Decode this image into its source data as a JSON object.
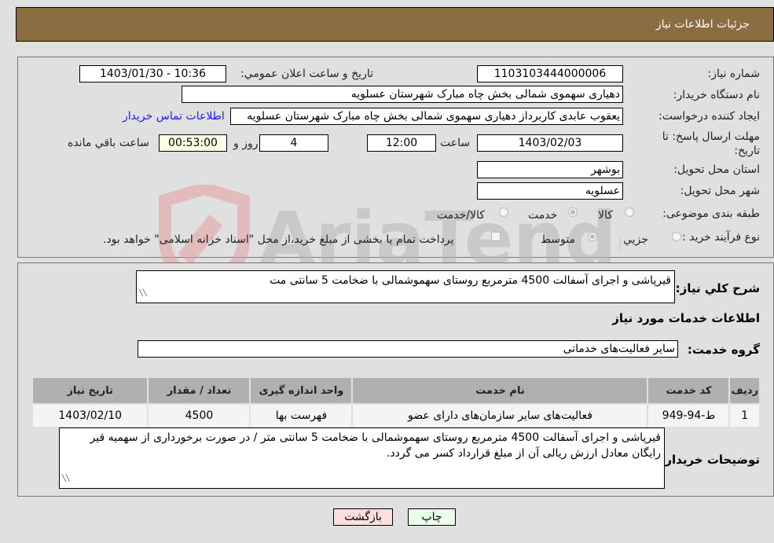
{
  "header": {
    "title": "جزئیات اطلاعات نیاز"
  },
  "fields": {
    "need_number": {
      "label": "شماره نیاز:",
      "value": "1103103444000006"
    },
    "announce_datetime": {
      "label": "تاریخ و ساعت اعلان عمومي:",
      "value": "1403/01/30 - 10:36"
    },
    "buyer_org": {
      "label": "نام دستگاه خریدار:",
      "value": "دهیاری سهموی شمالی بخش چاه مبارک شهرستان عسلویه"
    },
    "requester": {
      "label": "ایجاد کننده درخواست:",
      "value": "یعقوب عابدی کاربرداز دهیاری سهموی شمالی بخش چاه مبارک شهرستان عسلویه"
    },
    "contact_link": "اطلاعات تماس خریدار",
    "deadline": {
      "label": "مهلت ارسال پاسخ: تا تاریخ:",
      "date": "1403/02/03",
      "time_label": "ساعت",
      "time": "12:00",
      "days": "4",
      "days_label": "روز و",
      "remaining": "00:53:00",
      "remaining_label": "ساعت باقي مانده"
    },
    "province": {
      "label": "استان محل تحویل:",
      "value": "بوشهر"
    },
    "city": {
      "label": "شهر محل تحویل:",
      "value": "عسلویه"
    },
    "category": {
      "label": "طبقه بندی موضوعی:",
      "options": [
        "کالا",
        "خدمت",
        "کالا/خدمت"
      ],
      "selected": "خدمت"
    },
    "process_type": {
      "label": "نوع فرآیند خرید :",
      "options": [
        "جزيي",
        "متوسط"
      ],
      "selected": "متوسط",
      "treasury_note": "پرداخت تمام یا بخشی از مبلغ خرید،از محل \"اسناد خزانه اسلامی\" خواهد بود."
    }
  },
  "description": {
    "label": "شرح كلي نياز:",
    "value": "قیرپاشی و اجرای آسفالت 4500 مترمربع روستای سهموشمالی با ضخامت 5 سانتی مت"
  },
  "services_section_title": "اطلاعات خدمات مورد نیاز",
  "service_group": {
    "label": "گروه خدمت:",
    "value": "سایر فعالیت‌های خدماتی"
  },
  "table": {
    "headers": [
      "ردیف",
      "کد خدمت",
      "نام خدمت",
      "واحد اندازه گیری",
      "تعداد / مقدار",
      "تاریخ نیاز"
    ],
    "rows": [
      {
        "index": "1",
        "code": "ط-94-949",
        "name": "فعالیت‌های سایر سازمان‌های دارای عضو",
        "unit": "فهرست بها",
        "qty": "4500",
        "date": "1403/02/10"
      }
    ]
  },
  "buyer_notes": {
    "label": "توضیحات خریدار:",
    "value": "قیرپاشی و اجرای آسفالت 4500 مترمربع روستای سهموشمالی با ضخامت 5 سانتی متر / در صورت برخورداری از سهمیه قیر رایگان معادل ارزش ریالی آن از مبلغ قرارداد کسر می گردد."
  },
  "buttons": {
    "print": "چاپ",
    "back": "بازگشت"
  },
  "watermark": "AriaTender.neT"
}
